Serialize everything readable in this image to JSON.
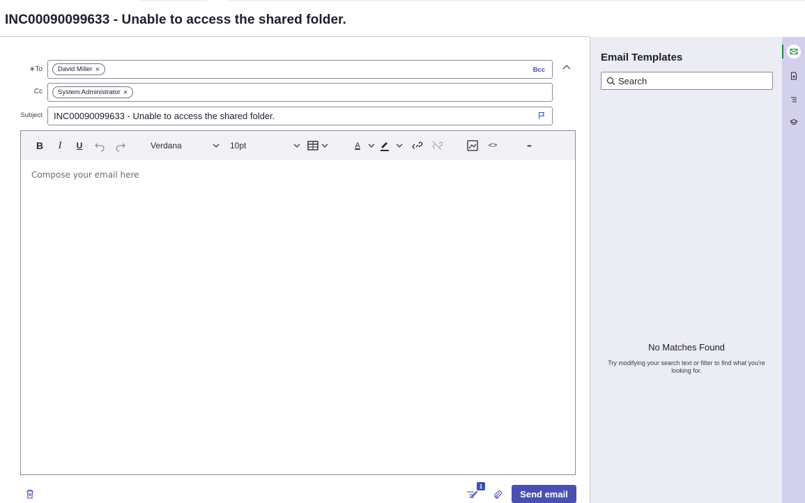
{
  "page": {
    "title": "INC00090099633 - Unable to access the shared folder."
  },
  "compose": {
    "to": {
      "label": "∗To",
      "recipients": [
        "David Miller"
      ],
      "bcc_label": "Bcc"
    },
    "cc": {
      "label": "Cc",
      "recipients": [
        "System Administrator"
      ]
    },
    "subject": {
      "label": "Subject",
      "value": "INC00090099633 - Unable to access the shared folder."
    },
    "toolbar": {
      "bold": "B",
      "italic": "I",
      "underline": "U",
      "font_family": "Verdana",
      "font_size": "10pt",
      "more": "•••",
      "text_color_letter": "A",
      "source_code": "<>"
    },
    "body_placeholder": "Compose your email here",
    "footer": {
      "badge_count": "1",
      "send_label": "Send email"
    }
  },
  "templates_panel": {
    "title": "Email Templates",
    "search_placeholder": "Search",
    "empty_title": "No Matches Found",
    "empty_body": "Try modifying your search text or filter to find what you're looking for."
  },
  "rail": {
    "items": [
      "email-icon",
      "add-document-icon",
      "list-icon",
      "graduation-cap-icon"
    ],
    "active_index": 0
  },
  "colors": {
    "accent": "#4a4fb0",
    "link": "#3a4fb8",
    "panel_bg": "#ececf4",
    "rail_bg": "#d3d0ec",
    "active_indicator": "#1a8a3a"
  }
}
